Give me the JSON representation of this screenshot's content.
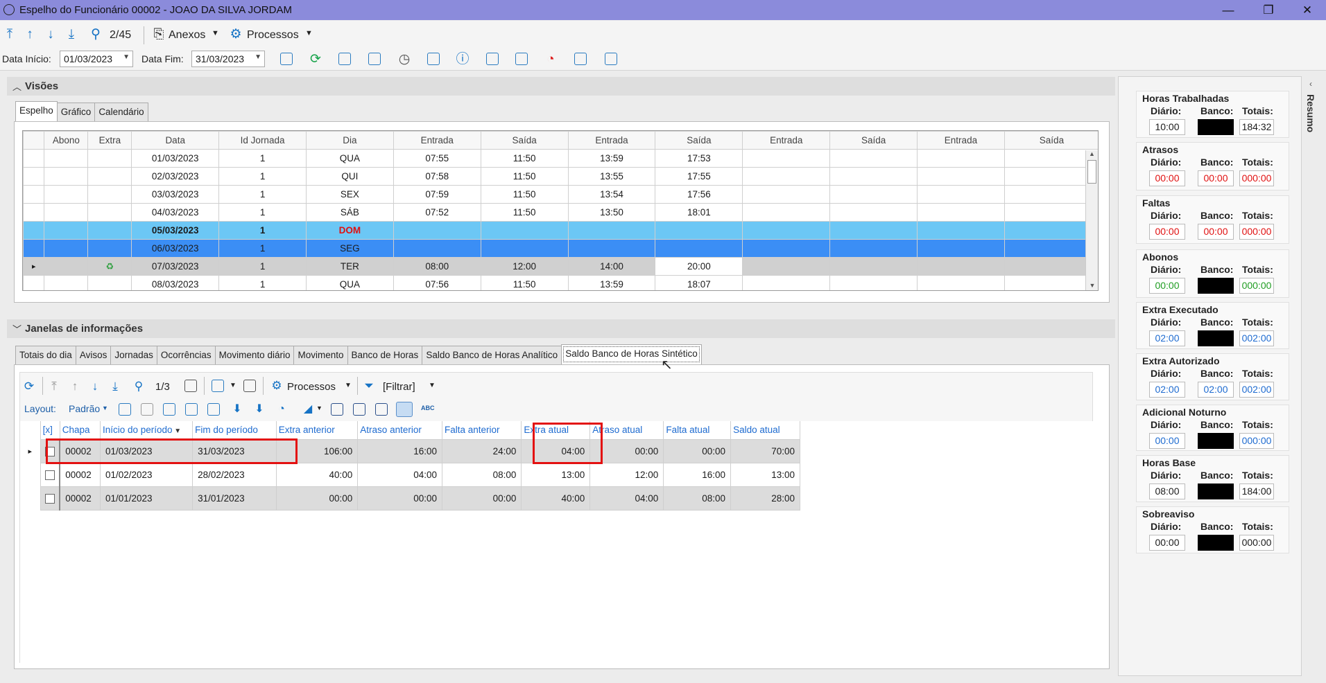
{
  "window": {
    "title": "Espelho do Funcionário 00002 - JOAO DA SILVA JORDAM"
  },
  "toolbar": {
    "counter": "2/45",
    "anexos": "Anexos",
    "processos": "Processos"
  },
  "filters": {
    "data_inicio_label": "Data Início:",
    "data_inicio": "01/03/2023",
    "data_fim_label": "Data Fim:",
    "data_fim": "31/03/2023"
  },
  "visoes": {
    "title": "Visões",
    "tabs": [
      "Espelho",
      "Gráfico",
      "Calendário"
    ],
    "columns": [
      "Abono",
      "Extra",
      "Data",
      "Id Jornada",
      "Dia",
      "Entrada",
      "Saída",
      "Entrada",
      "Saída",
      "Entrada",
      "Saída",
      "Entrada",
      "Saída"
    ],
    "rows": [
      [
        "",
        "",
        "01/03/2023",
        "1",
        "QUA",
        "07:55",
        "11:50",
        "13:59",
        "17:53",
        "",
        "",
        "",
        ""
      ],
      [
        "",
        "",
        "02/03/2023",
        "1",
        "QUI",
        "07:58",
        "11:50",
        "13:55",
        "17:55",
        "",
        "",
        "",
        ""
      ],
      [
        "",
        "",
        "03/03/2023",
        "1",
        "SEX",
        "07:59",
        "11:50",
        "13:54",
        "17:56",
        "",
        "",
        "",
        ""
      ],
      [
        "",
        "",
        "04/03/2023",
        "1",
        "SÁB",
        "07:52",
        "11:50",
        "13:50",
        "18:01",
        "",
        "",
        "",
        ""
      ],
      [
        "",
        "",
        "05/03/2023",
        "1",
        "DOM",
        "",
        "",
        "",
        "",
        "",
        "",
        "",
        ""
      ],
      [
        "",
        "",
        "06/03/2023",
        "1",
        "SEG",
        "",
        "",
        "",
        "",
        "",
        "",
        "",
        ""
      ],
      [
        "",
        "",
        "07/03/2023",
        "1",
        "TER",
        "08:00",
        "12:00",
        "14:00",
        "20:00",
        "",
        "",
        "",
        ""
      ],
      [
        "",
        "",
        "08/03/2023",
        "1",
        "QUA",
        "07:56",
        "11:50",
        "13:59",
        "18:07",
        "",
        "",
        "",
        ""
      ]
    ]
  },
  "janelas": {
    "title": "Janelas de informações",
    "tabs": [
      "Totais do dia",
      "Avisos",
      "Jornadas",
      "Ocorrências",
      "Movimento diário",
      "Movimento",
      "Banco de Horas",
      "Saldo Banco de Horas Analítico",
      "Saldo Banco de Horas Sintético"
    ],
    "counter": "1/3",
    "processos": "Processos",
    "filtrar": "[Filtrar]",
    "layout_label": "Layout:",
    "layout_value": "Padrão",
    "columns": [
      "[x]",
      "Chapa",
      "Início do período",
      "Fim do período",
      "Extra anterior",
      "Atraso anterior",
      "Falta anterior",
      "Extra atual",
      "Atraso atual",
      "Falta atual",
      "Saldo atual"
    ],
    "rows": [
      [
        "",
        "00002",
        "01/03/2023",
        "31/03/2023",
        "106:00",
        "16:00",
        "24:00",
        "04:00",
        "00:00",
        "00:00",
        "70:00"
      ],
      [
        "",
        "00002",
        "01/02/2023",
        "28/02/2023",
        "40:00",
        "04:00",
        "08:00",
        "13:00",
        "12:00",
        "16:00",
        "13:00"
      ],
      [
        "",
        "00002",
        "01/01/2023",
        "31/01/2023",
        "00:00",
        "00:00",
        "00:00",
        "40:00",
        "04:00",
        "08:00",
        "28:00"
      ]
    ]
  },
  "resumo": {
    "label": "Resumo",
    "sections": [
      {
        "title": "Horas Trabalhadas",
        "cols": [
          "Diário:",
          "Banco:",
          "Totais:"
        ],
        "values": [
          "10:00",
          "",
          "184:32"
        ],
        "color": "normal"
      },
      {
        "title": "Atrasos",
        "cols": [
          "Diário:",
          "Banco:",
          "Totais:"
        ],
        "values": [
          "00:00",
          "00:00",
          "000:00"
        ],
        "color": "red"
      },
      {
        "title": "Faltas",
        "cols": [
          "Diário:",
          "Banco:",
          "Totais:"
        ],
        "values": [
          "00:00",
          "00:00",
          "000:00"
        ],
        "color": "red"
      },
      {
        "title": "Abonos",
        "cols": [
          "Diário:",
          "Banco:",
          "Totais:"
        ],
        "values": [
          "00:00",
          "",
          "000:00"
        ],
        "color": "green"
      },
      {
        "title": "Extra Executado",
        "cols": [
          "Diário:",
          "Banco:",
          "Totais:"
        ],
        "values": [
          "02:00",
          "",
          "002:00"
        ],
        "color": "blue"
      },
      {
        "title": "Extra Autorizado",
        "cols": [
          "Diário:",
          "Banco:",
          "Totais:"
        ],
        "values": [
          "02:00",
          "02:00",
          "002:00"
        ],
        "color": "blue"
      },
      {
        "title": "Adicional Noturno",
        "cols": [
          "Diário:",
          "Banco:",
          "Totais:"
        ],
        "values": [
          "00:00",
          "",
          "000:00"
        ],
        "color": "blue"
      },
      {
        "title": "Horas Base",
        "cols": [
          "Diário:",
          "Banco:",
          "Totais:"
        ],
        "values": [
          "08:00",
          "",
          "184:00"
        ],
        "color": "normal"
      },
      {
        "title": "Sobreaviso",
        "cols": [
          "Diário:",
          "Banco:",
          "Totais:"
        ],
        "values": [
          "00:00",
          "",
          "000:00"
        ],
        "color": "normal"
      }
    ]
  }
}
